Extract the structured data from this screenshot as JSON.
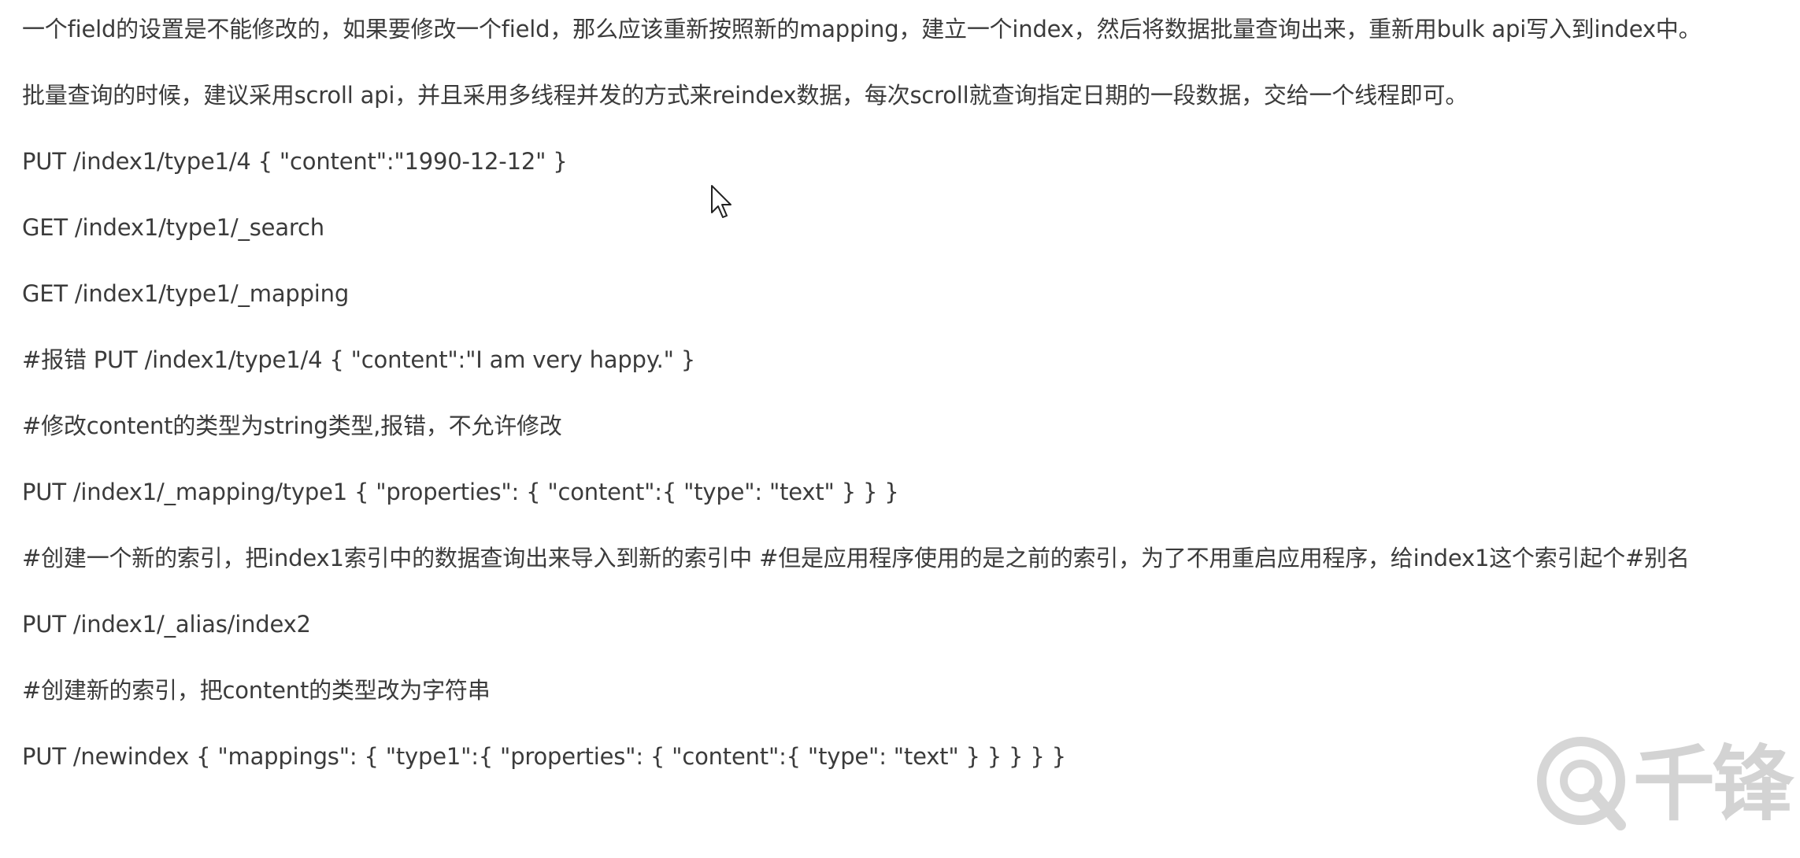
{
  "paragraphs": [
    "一个field的设置是不能修改的，如果要修改一个field，那么应该重新按照新的mapping，建立一个index，然后将数据批量查询出来，重新用bulk api写入到index中。",
    "批量查询的时候，建议采用scroll api，并且采用多线程并发的方式来reindex数据，每次scroll就查询指定日期的一段数据，交给一个线程即可。",
    "PUT /index1/type1/4 { \"content\":\"1990-12-12\" }",
    "GET /index1/type1/_search",
    "GET /index1/type1/_mapping",
    "#报错 PUT /index1/type1/4 { \"content\":\"I am very happy.\" }",
    "#修改content的类型为string类型,报错，不允许修改",
    "PUT /index1/_mapping/type1 { \"properties\": { \"content\":{ \"type\": \"text\" } } }",
    "#创建一个新的索引，把index1索引中的数据查询出来导入到新的索引中 #但是应用程序使用的是之前的索引，为了不用重启应用程序，给index1这个索引起个#别名",
    "PUT /index1/_alias/index2",
    "#创建新的索引，把content的类型改为字符串",
    "PUT /newindex { \"mappings\": { \"type1\":{ \"properties\": { \"content\":{ \"type\": \"text\" } } } } }"
  ],
  "watermark": {
    "logo_icon": "qianfeng-logo-icon",
    "text": "千锋"
  },
  "colors": {
    "text": "#3b3b3b",
    "background": "#ffffff",
    "watermark": "#9a9a9a"
  }
}
